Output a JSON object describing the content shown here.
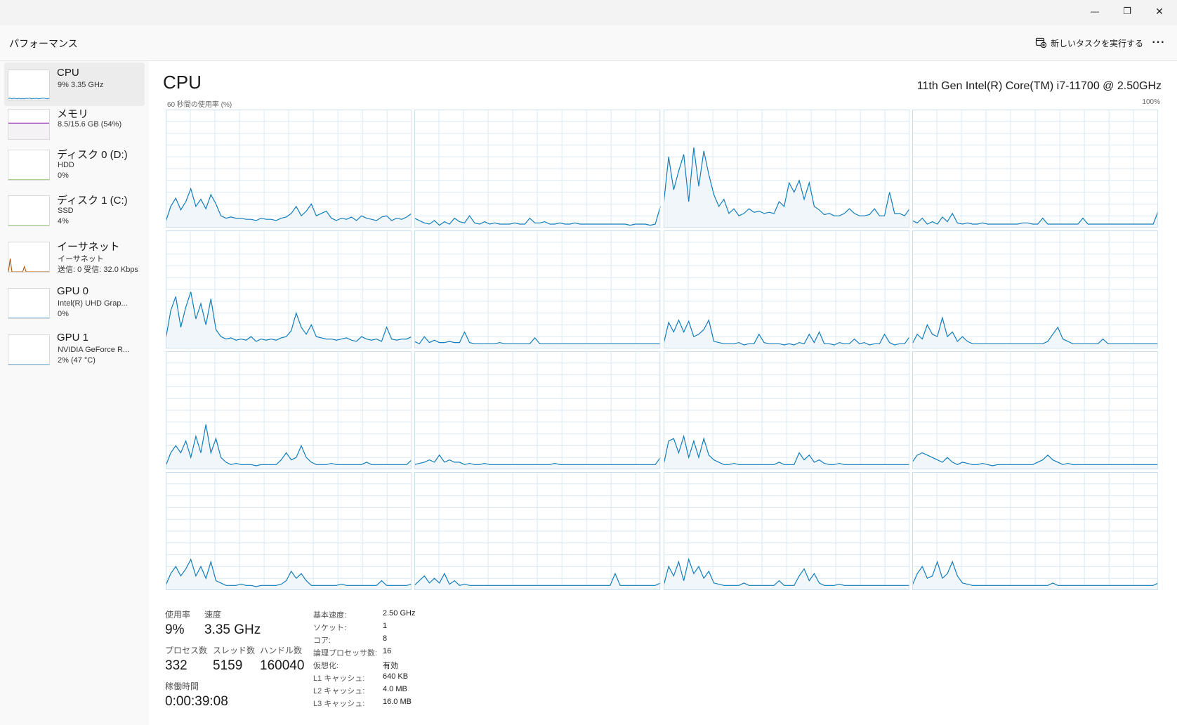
{
  "window": {
    "minimize_symbol": "—",
    "maximize_symbol": "❐",
    "close_symbol": "✕"
  },
  "commandbar": {
    "title": "パフォーマンス",
    "run_task_label": "新しいタスクを実行する",
    "run_task_icon": "new-task-icon",
    "more_label": "···"
  },
  "sidebar": {
    "items": [
      {
        "name": "CPU",
        "sub1": "9%  3.35 GHz",
        "sub2": "",
        "color": "#117dbb",
        "fill": "#f1f6fa",
        "selected": true
      },
      {
        "name": "メモリ",
        "sub1": "8.5/15.6 GB (54%)",
        "sub2": "",
        "color": "#8b12ae",
        "fill": "#f4f2f4",
        "selected": false
      },
      {
        "name": "ディスク 0 (D:)",
        "sub1": "HDD",
        "sub2": "0%",
        "color": "#4da60c",
        "fill": "#eff7e8",
        "selected": false
      },
      {
        "name": "ディスク 1 (C:)",
        "sub1": "SSD",
        "sub2": "4%",
        "color": "#4da60c",
        "fill": "#eff7e8",
        "selected": false
      },
      {
        "name": "イーサネット",
        "sub1": "イーサネット",
        "sub2": "送信: 0  受信: 32.0 Kbps",
        "color": "#a74f01",
        "fill": "#fcf3eb",
        "selected": false
      },
      {
        "name": "GPU 0",
        "sub1": "Intel(R) UHD Grap...",
        "sub2": "0%",
        "color": "#117dbb",
        "fill": "#f1f6fa",
        "selected": false
      },
      {
        "name": "GPU 1",
        "sub1": "NVIDIA GeForce R...",
        "sub2": "2%  (47 °C)",
        "color": "#117dbb",
        "fill": "#f1f6fa",
        "selected": false
      }
    ]
  },
  "main": {
    "title": "CPU",
    "cpu_model": "11th Gen Intel(R) Core(TM) i7-11700 @ 2.50GHz",
    "graph_caption": "60 秒間の使用率 (%)",
    "graph_max": "100%",
    "line_color": "#117dbb",
    "fill_color": "#f1f6fa",
    "grid_color": "#d9eaf4"
  },
  "chart_data": {
    "type": "area",
    "title": "",
    "xlabel": "",
    "ylabel": "60 秒間の使用率 (%)",
    "ylim": [
      0,
      100
    ],
    "x_range_seconds": 60,
    "grid": true,
    "series": [
      {
        "values": [
          5,
          18,
          25,
          15,
          22,
          33,
          18,
          24,
          16,
          28,
          20,
          10,
          8,
          9,
          8,
          8,
          7,
          7,
          6,
          8,
          7,
          7,
          6,
          8,
          9,
          12,
          18,
          10,
          14,
          20,
          10,
          12,
          14,
          8,
          6,
          8,
          7,
          9,
          6,
          10,
          8,
          7,
          6,
          9,
          10,
          6,
          8,
          7,
          9,
          12
        ]
      },
      {
        "values": [
          8,
          6,
          4,
          3,
          6,
          2,
          5,
          3,
          8,
          5,
          4,
          10,
          4,
          3,
          5,
          3,
          4,
          3,
          3,
          3,
          4,
          3,
          3,
          8,
          4,
          4,
          5,
          3,
          3,
          4,
          3,
          3,
          4,
          3,
          3,
          3,
          3,
          3,
          3,
          3,
          3,
          3,
          3,
          2,
          3,
          3,
          3,
          2,
          3,
          18
        ]
      },
      {
        "values": [
          20,
          60,
          32,
          48,
          62,
          22,
          68,
          35,
          65,
          45,
          28,
          18,
          24,
          12,
          16,
          10,
          12,
          16,
          13,
          14,
          12,
          13,
          12,
          22,
          18,
          38,
          30,
          40,
          24,
          38,
          18,
          15,
          11,
          12,
          10,
          10,
          12,
          16,
          12,
          10,
          10,
          11,
          16,
          10,
          10,
          30,
          12,
          12,
          10,
          16
        ]
      },
      {
        "values": [
          6,
          4,
          8,
          3,
          5,
          3,
          9,
          5,
          12,
          4,
          3,
          4,
          3,
          3,
          4,
          3,
          3,
          3,
          3,
          3,
          3,
          3,
          4,
          4,
          3,
          3,
          8,
          3,
          3,
          3,
          3,
          3,
          3,
          3,
          8,
          3,
          3,
          3,
          3,
          3,
          3,
          3,
          3,
          3,
          3,
          3,
          3,
          3,
          3,
          14
        ]
      },
      {
        "values": [
          8,
          32,
          44,
          18,
          35,
          48,
          25,
          38,
          20,
          42,
          16,
          10,
          8,
          9,
          7,
          8,
          7,
          10,
          6,
          8,
          7,
          8,
          7,
          9,
          10,
          15,
          30,
          18,
          12,
          20,
          10,
          9,
          8,
          8,
          7,
          8,
          9,
          7,
          6,
          10,
          8,
          7,
          8,
          6,
          18,
          8,
          7,
          8,
          8,
          10
        ]
      },
      {
        "values": [
          6,
          4,
          10,
          5,
          7,
          5,
          5,
          6,
          5,
          5,
          14,
          5,
          4,
          4,
          4,
          4,
          4,
          5,
          4,
          4,
          4,
          4,
          4,
          4,
          9,
          4,
          4,
          4,
          4,
          4,
          4,
          4,
          4,
          4,
          4,
          4,
          4,
          4,
          4,
          4,
          4,
          4,
          4,
          4,
          4,
          4,
          4,
          4,
          4,
          4
        ]
      },
      {
        "values": [
          4,
          22,
          14,
          24,
          14,
          23,
          10,
          12,
          16,
          24,
          6,
          5,
          4,
          4,
          4,
          5,
          3,
          4,
          4,
          12,
          5,
          4,
          4,
          4,
          3,
          4,
          3,
          5,
          4,
          12,
          5,
          14,
          4,
          4,
          3,
          5,
          4,
          4,
          8,
          4,
          5,
          3,
          4,
          4,
          12,
          5,
          3,
          4,
          4,
          10
        ]
      },
      {
        "values": [
          4,
          12,
          8,
          20,
          12,
          10,
          26,
          10,
          14,
          6,
          10,
          6,
          4,
          4,
          4,
          4,
          4,
          4,
          4,
          4,
          4,
          4,
          4,
          4,
          4,
          4,
          4,
          6,
          12,
          18,
          8,
          6,
          4,
          4,
          4,
          4,
          4,
          4,
          8,
          4,
          4,
          4,
          4,
          4,
          4,
          4,
          4,
          4,
          4,
          4
        ]
      },
      {
        "values": [
          3,
          14,
          20,
          14,
          24,
          10,
          28,
          14,
          38,
          14,
          26,
          10,
          6,
          4,
          5,
          4,
          4,
          4,
          3,
          4,
          4,
          4,
          4,
          8,
          14,
          8,
          10,
          20,
          10,
          6,
          4,
          4,
          4,
          5,
          4,
          4,
          4,
          4,
          4,
          4,
          6,
          4,
          4,
          4,
          4,
          4,
          4,
          4,
          4,
          8
        ]
      },
      {
        "values": [
          4,
          5,
          6,
          8,
          6,
          12,
          6,
          8,
          6,
          6,
          4,
          5,
          4,
          4,
          5,
          4,
          4,
          4,
          4,
          4,
          4,
          4,
          4,
          4,
          4,
          4,
          4,
          4,
          5,
          4,
          4,
          4,
          4,
          4,
          4,
          4,
          4,
          4,
          4,
          4,
          4,
          4,
          4,
          4,
          4,
          4,
          4,
          4,
          4,
          10
        ]
      },
      {
        "values": [
          4,
          24,
          26,
          14,
          28,
          10,
          24,
          10,
          26,
          12,
          8,
          6,
          4,
          4,
          5,
          4,
          4,
          4,
          4,
          4,
          4,
          4,
          4,
          6,
          4,
          4,
          4,
          14,
          8,
          12,
          6,
          8,
          5,
          4,
          4,
          5,
          4,
          4,
          4,
          4,
          4,
          4,
          4,
          4,
          4,
          4,
          4,
          4,
          4,
          4
        ]
      },
      {
        "values": [
          6,
          12,
          14,
          12,
          10,
          8,
          6,
          10,
          6,
          4,
          6,
          5,
          4,
          4,
          5,
          4,
          3,
          4,
          4,
          4,
          4,
          4,
          4,
          4,
          4,
          6,
          8,
          12,
          8,
          6,
          4,
          5,
          4,
          4,
          4,
          4,
          4,
          4,
          4,
          4,
          4,
          4,
          4,
          4,
          4,
          4,
          4,
          4,
          4,
          4
        ]
      },
      {
        "values": [
          4,
          14,
          20,
          12,
          18,
          26,
          12,
          20,
          10,
          24,
          8,
          6,
          4,
          4,
          4,
          5,
          4,
          4,
          3,
          4,
          4,
          4,
          4,
          5,
          8,
          16,
          10,
          14,
          8,
          4,
          4,
          4,
          4,
          4,
          4,
          5,
          4,
          4,
          4,
          4,
          4,
          4,
          4,
          8,
          4,
          4,
          4,
          4,
          4,
          5
        ]
      },
      {
        "values": [
          4,
          8,
          12,
          6,
          10,
          6,
          14,
          5,
          8,
          4,
          5,
          4,
          4,
          4,
          4,
          4,
          4,
          4,
          4,
          4,
          4,
          4,
          4,
          4,
          4,
          4,
          4,
          4,
          4,
          4,
          4,
          4,
          4,
          4,
          4,
          4,
          4,
          4,
          4,
          4,
          14,
          4,
          4,
          4,
          4,
          4,
          4,
          4,
          4,
          6
        ]
      },
      {
        "values": [
          4,
          20,
          12,
          24,
          8,
          26,
          14,
          20,
          10,
          16,
          6,
          5,
          4,
          4,
          4,
          4,
          6,
          4,
          4,
          4,
          4,
          4,
          4,
          8,
          4,
          4,
          4,
          12,
          18,
          8,
          14,
          6,
          4,
          4,
          4,
          5,
          4,
          4,
          4,
          4,
          4,
          4,
          4,
          4,
          4,
          4,
          4,
          4,
          4,
          4
        ]
      },
      {
        "values": [
          4,
          14,
          20,
          10,
          12,
          24,
          10,
          14,
          24,
          12,
          6,
          5,
          4,
          4,
          4,
          4,
          4,
          4,
          4,
          4,
          4,
          4,
          4,
          4,
          4,
          4,
          4,
          4,
          6,
          4,
          4,
          4,
          4,
          4,
          4,
          4,
          4,
          4,
          4,
          4,
          4,
          4,
          4,
          4,
          4,
          4,
          4,
          4,
          4,
          6
        ]
      }
    ]
  },
  "sidebar_thumbs": [
    [
      4,
      6,
      3,
      5,
      4,
      3,
      5,
      3,
      4,
      3,
      5,
      4,
      6,
      3,
      4,
      4,
      5,
      3,
      4,
      5,
      6,
      4,
      3,
      5
    ],
    [
      54,
      54,
      54,
      54,
      54,
      54,
      54,
      54,
      54,
      54,
      54,
      54,
      54,
      54,
      54,
      54,
      54,
      54,
      54,
      54,
      54,
      54,
      54,
      54
    ],
    [
      0,
      0,
      0,
      0,
      0,
      0,
      0,
      0,
      0,
      0,
      0,
      0,
      0,
      0,
      0,
      0,
      0,
      0,
      0,
      0,
      0,
      0,
      0,
      0
    ],
    [
      0,
      0,
      0,
      0,
      0,
      0,
      0,
      0,
      0,
      0,
      0,
      0,
      0,
      0,
      0,
      0,
      0,
      0,
      0,
      0,
      0,
      0,
      0,
      0
    ],
    [
      0,
      45,
      0,
      0,
      0,
      0,
      0,
      0,
      0,
      18,
      0,
      0,
      0,
      0,
      0,
      0,
      0,
      0,
      0,
      0,
      0,
      0,
      0,
      0
    ],
    [
      0,
      0,
      0,
      0,
      0,
      0,
      0,
      0,
      0,
      0,
      0,
      0,
      0,
      0,
      0,
      0,
      0,
      0,
      0,
      0,
      0,
      0,
      0,
      0
    ],
    [
      0,
      0,
      0,
      0,
      0,
      0,
      0,
      0,
      0,
      0,
      0,
      0,
      0,
      0,
      0,
      0,
      0,
      0,
      0,
      0,
      0,
      0,
      0,
      0
    ]
  ],
  "stats": {
    "usage_label": "使用率",
    "usage_value": "9%",
    "speed_label": "速度",
    "speed_value": "3.35 GHz",
    "processes_label": "プロセス数",
    "processes_value": "332",
    "threads_label": "スレッド数",
    "threads_value": "5159",
    "handles_label": "ハンドル数",
    "handles_value": "160040",
    "uptime_label": "稼働時間",
    "uptime_value": "0:00:39:08"
  },
  "info": [
    {
      "key": "基本速度:",
      "value": "2.50 GHz"
    },
    {
      "key": "ソケット:",
      "value": "1"
    },
    {
      "key": "コア:",
      "value": "8"
    },
    {
      "key": "論理プロセッサ数:",
      "value": "16"
    },
    {
      "key": "仮想化:",
      "value": "有効"
    },
    {
      "key": "L1 キャッシュ:",
      "value": "640 KB"
    },
    {
      "key": "L2 キャッシュ:",
      "value": "4.0 MB"
    },
    {
      "key": "L3 キャッシュ:",
      "value": "16.0 MB"
    }
  ]
}
